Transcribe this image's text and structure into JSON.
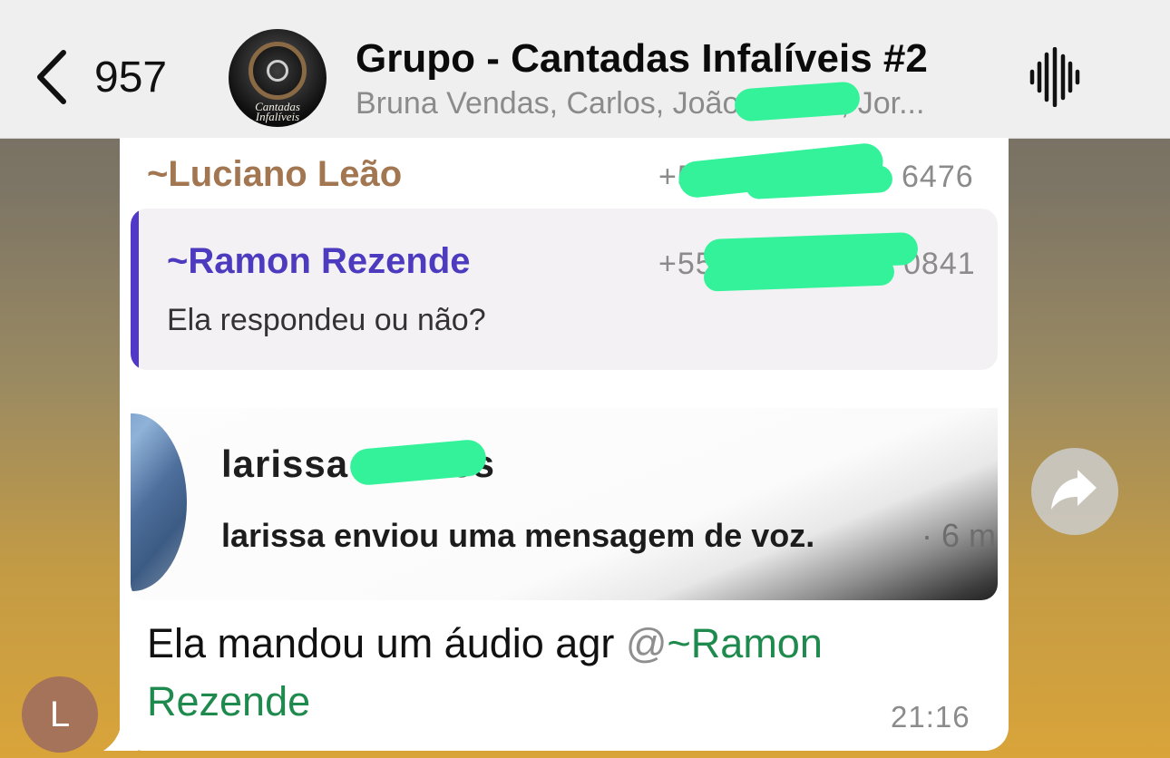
{
  "header": {
    "back_count": "957",
    "group_name": "Grupo - Cantadas Infalíveis #2",
    "members": "Bruna Vendas, Carlos, João Morais, Jor...",
    "avatar_caption_line1": "Cantadas",
    "avatar_caption_line2": "Infalíveis"
  },
  "message": {
    "sender_name": "~Luciano Leão",
    "sender_phone_start": "+55 ",
    "sender_phone_end": "6476",
    "reply": {
      "name": "~Ramon Rezende",
      "phone_start": "+55",
      "phone_end": "0841",
      "text": "Ela respondeu ou não?"
    },
    "image": {
      "name_prefix": "larissa",
      "name_suffix": "os",
      "notification": "larissa enviou uma mensagem de voz.",
      "time_fragment": "· 6 m"
    },
    "text": "Ela mandou um áudio agr ",
    "mention_at": "@",
    "mention_name": "~Ramon Rezende",
    "time": "21:16"
  },
  "user_avatar_initial": "L",
  "colors": {
    "sender": "#a17650",
    "reply_accent": "#5138c8",
    "mention": "#1f8a4d",
    "redaction": "#33f29a"
  },
  "icons": [
    "back-chevron-icon",
    "group-avatar",
    "voice-waveform-icon",
    "forward-icon"
  ]
}
